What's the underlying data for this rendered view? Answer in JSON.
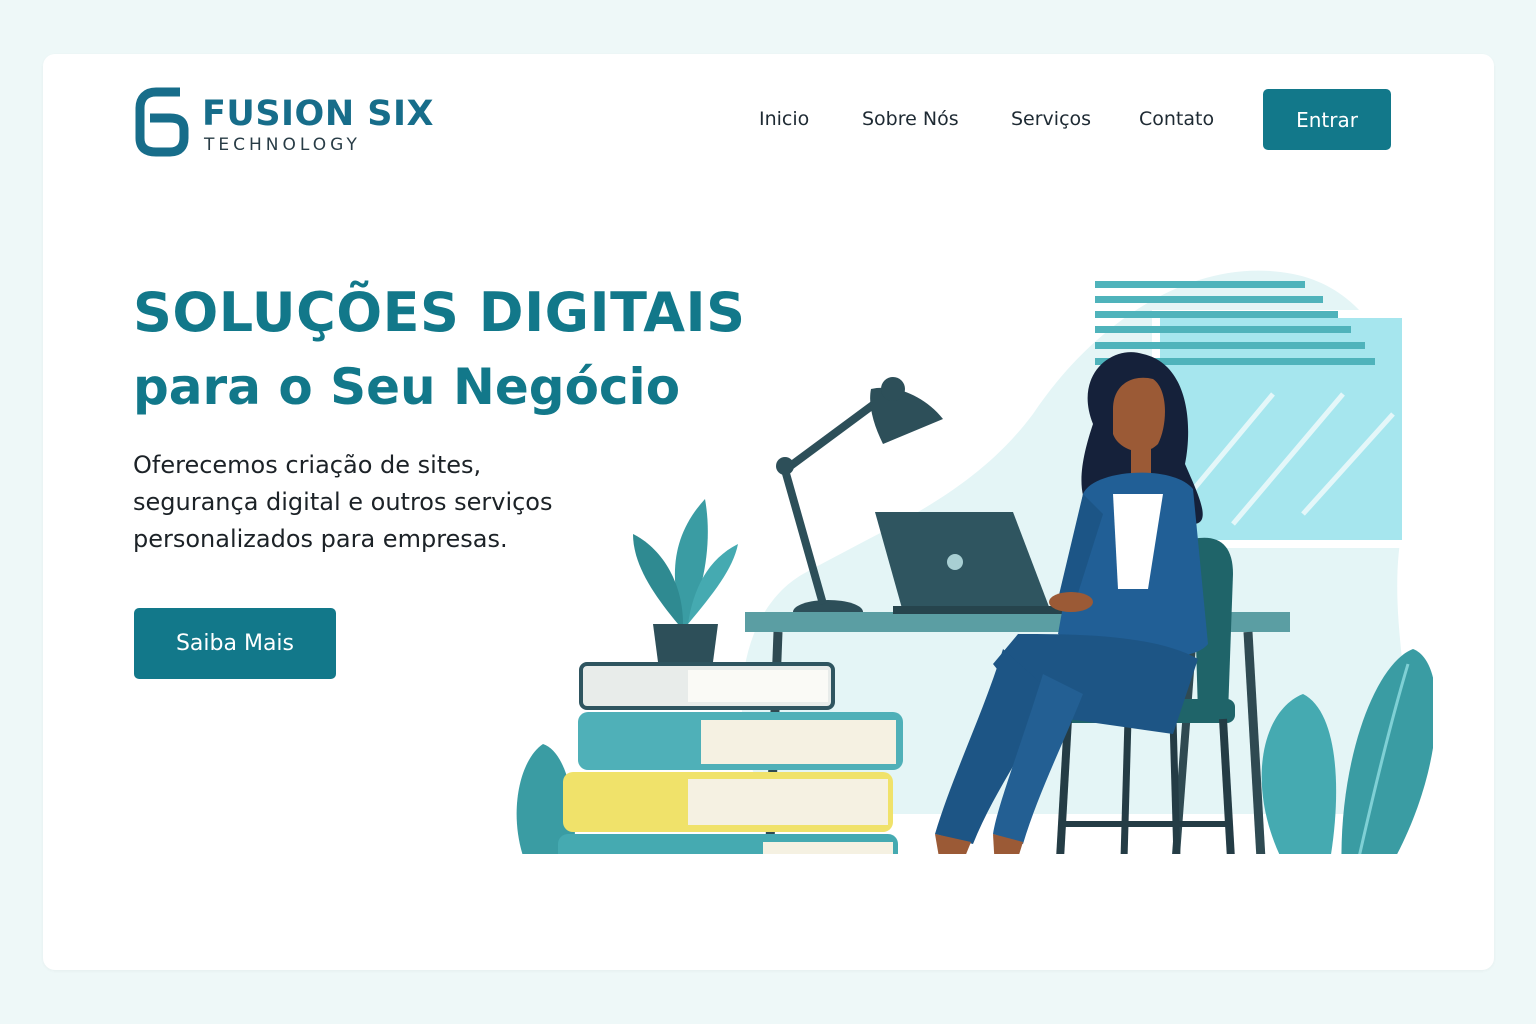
{
  "logo": {
    "mark": "6",
    "name": "FUSION SIX",
    "subtitle": "TECHNOLOGY"
  },
  "nav": {
    "items": [
      {
        "label": "Inicio"
      },
      {
        "label": "Sobre Nós"
      },
      {
        "label": "Serviços"
      },
      {
        "label": "Contato"
      }
    ],
    "login_label": "Entrar"
  },
  "hero": {
    "title_line1": "SOLUÇÕES DIGITAIS",
    "title_line2": "para o Seu Negócio",
    "description": "Oferecemos criação de sites, segurança digital e outros serviços personalizados para empresas.",
    "cta_label": "Saiba Mais"
  },
  "illustration": {
    "icon": "woman-working-at-laptop-illustration"
  },
  "colors": {
    "brand": "#12788a",
    "logo": "#176d8a",
    "background": "#eef8f8",
    "card": "#ffffff",
    "text": "#1c2227"
  }
}
